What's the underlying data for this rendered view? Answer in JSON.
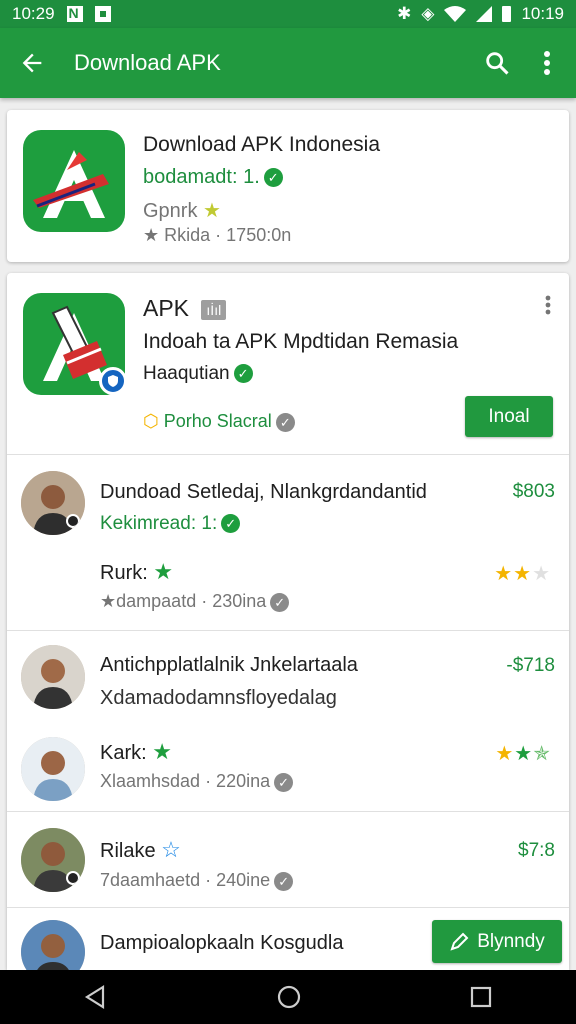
{
  "status": {
    "time_left": "10:29",
    "time_right": "10:19"
  },
  "appbar": {
    "title": "Download APK"
  },
  "card1": {
    "title": "Download APK Indonesia",
    "subtitle": "bodamadt: 1.",
    "category": "Gpnrk",
    "meta": "Rkida · 1750:0n"
  },
  "card2": {
    "title": "APK",
    "badge": "ıİıl",
    "desc": "Indoah ta APK Mpdtidan Remasia",
    "sub": "Haaqutian",
    "tag": "Porho Slacral",
    "install_label": "Inoal",
    "rows": [
      {
        "title": "Dundoad Setledaj, Nlankgrdandantid",
        "sub": "Kekimread: 1:",
        "price": "$803",
        "rank": "Rurk:",
        "meta": "dampaatd · 230ina"
      },
      {
        "title": "Antichpplatlalnik Jnkelartaala",
        "sub": "Xdamadodamnsfloyedalag",
        "price": "-$718",
        "rank": "Kark:",
        "meta": "Xlaamhsdad · 220ina"
      },
      {
        "title": "Rilake",
        "price": "$7:8",
        "meta": "7daamhaetd · 240ine"
      },
      {
        "title": "Dampioalopkaaln Kosgudla",
        "button": "Blynndy"
      }
    ]
  },
  "colors": {
    "primary": "#21993f",
    "star_gold": "#f4b400",
    "star_green": "#1e9e3e"
  }
}
